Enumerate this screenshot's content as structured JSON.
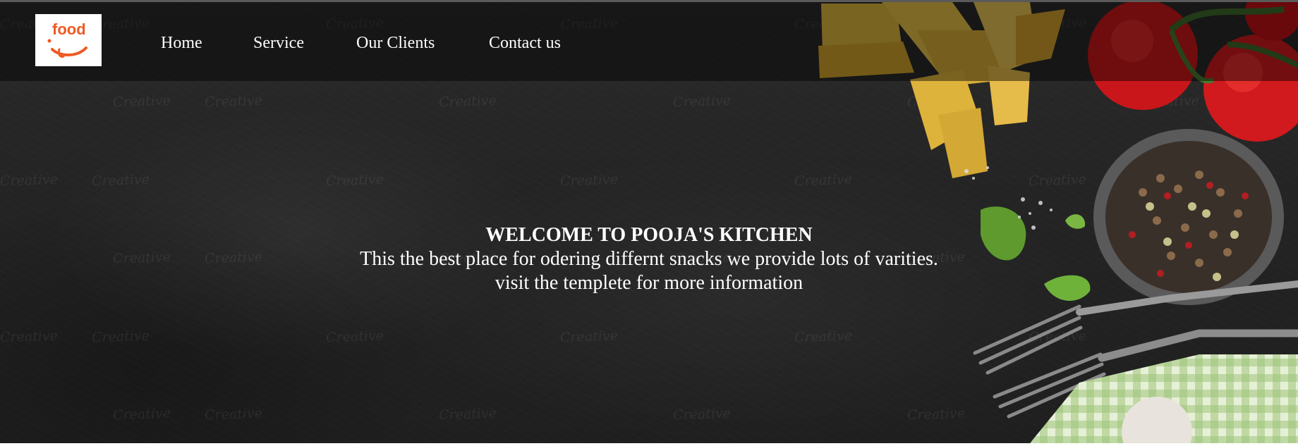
{
  "brand": {
    "logo_text": "food",
    "logo_color": "#ee5a24"
  },
  "nav": {
    "items": [
      {
        "label": "Home"
      },
      {
        "label": "Service"
      },
      {
        "label": "Our Clients"
      },
      {
        "label": "Contact us"
      }
    ]
  },
  "hero": {
    "title": "WELCOME TO POOJA'S KITCHEN",
    "line1": "This the best place for odering differnt snacks we provide lots of varities.",
    "line2": "visit the templete for more information",
    "background_color": "#242424",
    "watermark_text": "Creative"
  },
  "icons": {
    "logo": "food-logo-icon"
  }
}
